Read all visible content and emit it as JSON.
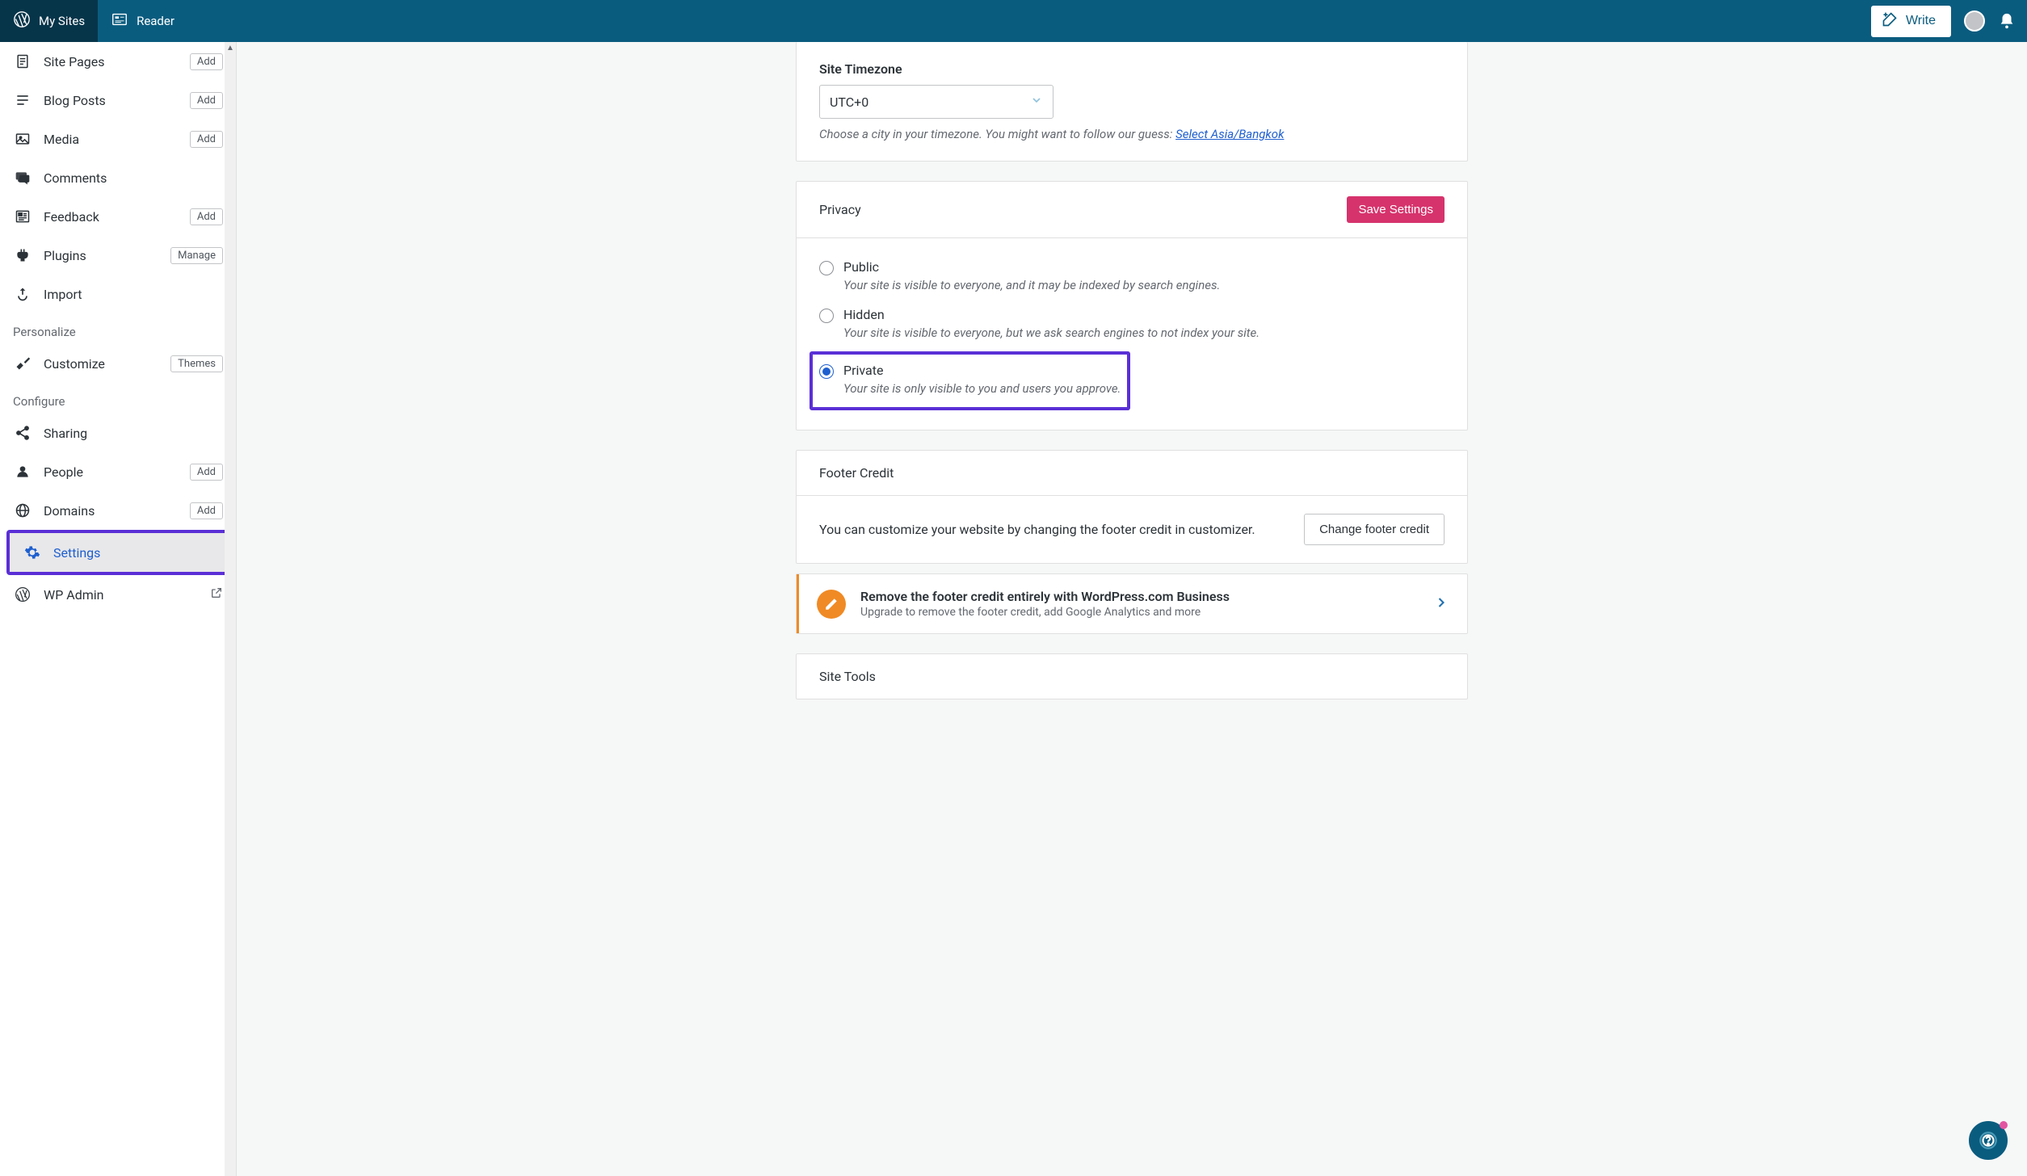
{
  "topbar": {
    "my_sites": "My Sites",
    "reader": "Reader",
    "write": "Write"
  },
  "sidebar": {
    "items": [
      {
        "label": "Site Pages",
        "badge": "Add"
      },
      {
        "label": "Blog Posts",
        "badge": "Add"
      },
      {
        "label": "Media",
        "badge": "Add"
      },
      {
        "label": "Comments"
      },
      {
        "label": "Feedback",
        "badge": "Add"
      },
      {
        "label": "Plugins",
        "badge": "Manage"
      },
      {
        "label": "Import"
      }
    ],
    "personalize_header": "Personalize",
    "customize": {
      "label": "Customize",
      "badge": "Themes"
    },
    "configure_header": "Configure",
    "configure": [
      {
        "label": "Sharing"
      },
      {
        "label": "People",
        "badge": "Add"
      },
      {
        "label": "Domains",
        "badge": "Add"
      },
      {
        "label": "Settings",
        "selected": true
      },
      {
        "label": "WP Admin"
      }
    ]
  },
  "timezone": {
    "label": "Site Timezone",
    "value": "UTC+0",
    "helper_prefix": "Choose a city in your timezone. You might want to follow our guess: ",
    "helper_link": "Select Asia/Bangkok"
  },
  "privacy": {
    "header": "Privacy",
    "save": "Save Settings",
    "options": [
      {
        "label": "Public",
        "desc": "Your site is visible to everyone, and it may be indexed by search engines.",
        "checked": false
      },
      {
        "label": "Hidden",
        "desc": "Your site is visible to everyone, but we ask search engines to not index your site.",
        "checked": false
      },
      {
        "label": "Private",
        "desc": "Your site is only visible to you and users you approve.",
        "checked": true,
        "highlight": true
      }
    ]
  },
  "footer_credit": {
    "header": "Footer Credit",
    "text": "You can customize your website by changing the footer credit in customizer.",
    "button": "Change footer credit",
    "upsell_title": "Remove the footer credit entirely with WordPress.com Business",
    "upsell_sub": "Upgrade to remove the footer credit, add Google Analytics and more"
  },
  "site_tools": {
    "header": "Site Tools"
  }
}
